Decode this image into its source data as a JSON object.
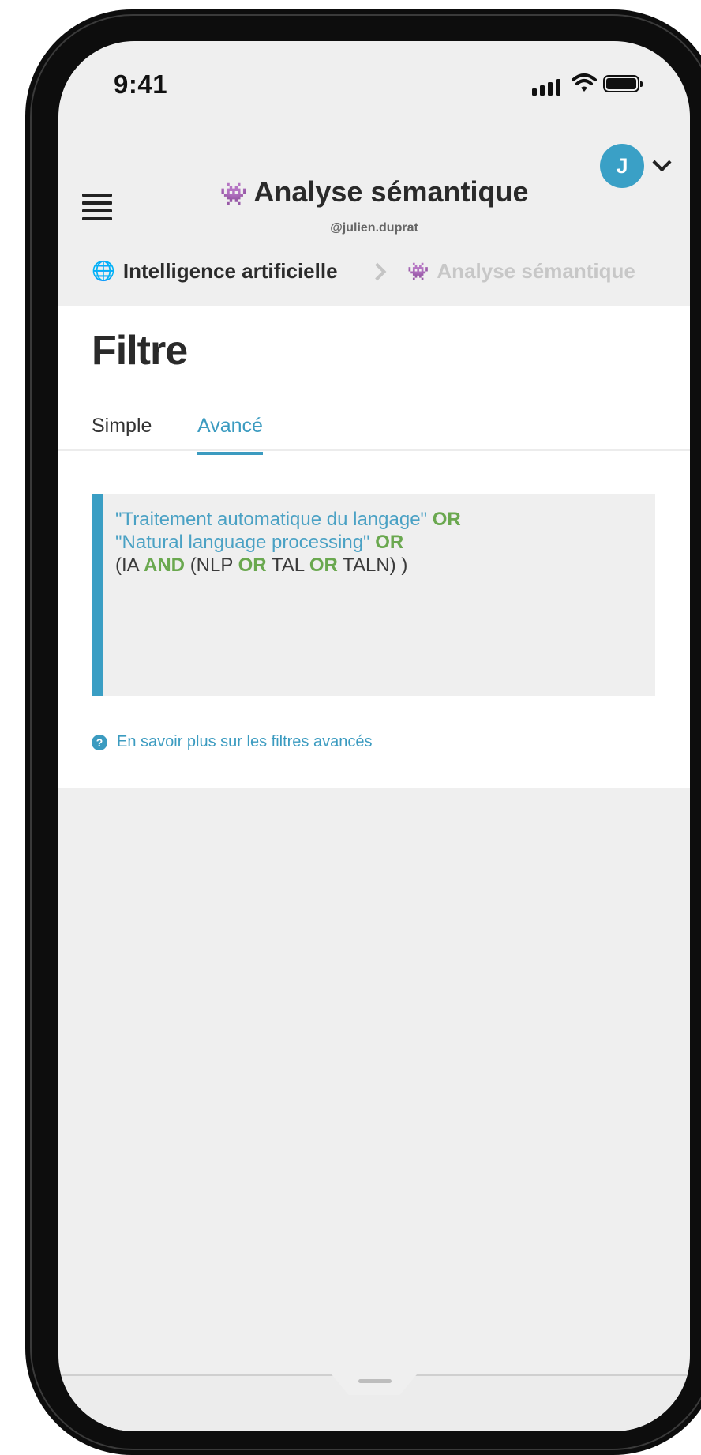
{
  "status": {
    "time": "9:41"
  },
  "header": {
    "title_icon": "space-invader-icon",
    "title": "Analyse sémantique",
    "subtitle": "@julien.duprat",
    "avatar_initial": "J"
  },
  "breadcrumb": {
    "items": [
      {
        "icon": "globe-icon",
        "label": "Intelligence artificielle"
      },
      {
        "icon": "space-invader-icon",
        "label": "Analyse sémantique"
      }
    ]
  },
  "filter": {
    "title": "Filtre",
    "tabs": [
      "Simple",
      "Avancé"
    ],
    "active_tab": "Avancé",
    "query": {
      "line1_str": "\"Traitement automatique du langage\"",
      "line1_op": "OR",
      "line2_str": "\"Natural language processing\"",
      "line2_op": "OR",
      "line3_a": "(IA",
      "line3_op1": "AND",
      "line3_b": "(NLP",
      "line3_op2": "OR",
      "line3_c": "TAL",
      "line3_op3": "OR",
      "line3_d": "TALN) )"
    },
    "help_link": "En savoir plus sur les filtres avancés"
  },
  "colors": {
    "accent": "#3b9bc0",
    "operator": "#6aa84f",
    "avatar": "#3aa0c6"
  }
}
